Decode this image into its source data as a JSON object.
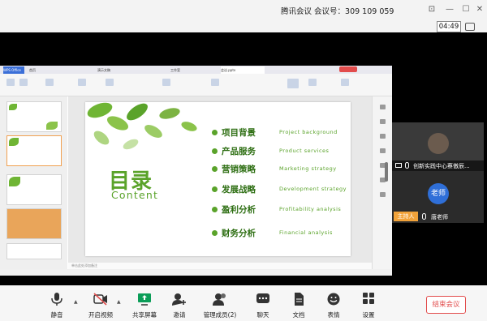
{
  "window": {
    "title": "腾讯会议  会议号：309 109 059",
    "timer": "04:49"
  },
  "share": {
    "tabs": [
      "WPS Office",
      "首页",
      "演示文稿",
      "工作室",
      "会议.pptx"
    ],
    "notes_hint": "单击此处添加备注"
  },
  "slide": {
    "title_cn": "目录",
    "title_en": "Content",
    "items": [
      {
        "cn": "项目背景",
        "en": "Project background"
      },
      {
        "cn": "产品服务",
        "en": "Product services"
      },
      {
        "cn": "营销策略",
        "en": "Marketing strategy"
      },
      {
        "cn": "发展战略",
        "en": "Development strategy"
      },
      {
        "cn": "盈利分析",
        "en": "Profitability analysis"
      },
      {
        "cn": "财务分析",
        "en": "Financial analysis"
      }
    ]
  },
  "participants": {
    "p1_name": "创新实践中心蔡傲辰...",
    "p2_avatar": "老师",
    "host_badge": "主持人",
    "p2_name": "唐老师"
  },
  "toolbar": {
    "mute": "静音",
    "video": "开启视频",
    "share": "共享屏幕",
    "invite": "邀请",
    "members": "管理成员(2)",
    "chat": "聊天",
    "docs": "文档",
    "reaction": "表情",
    "settings": "设置",
    "end": "结束会议"
  },
  "colors": {
    "accent_green": "#5aa32a",
    "end_red": "#e24c4c",
    "avatar_blue": "#2f6fd8",
    "host_orange": "#f2a33a"
  }
}
